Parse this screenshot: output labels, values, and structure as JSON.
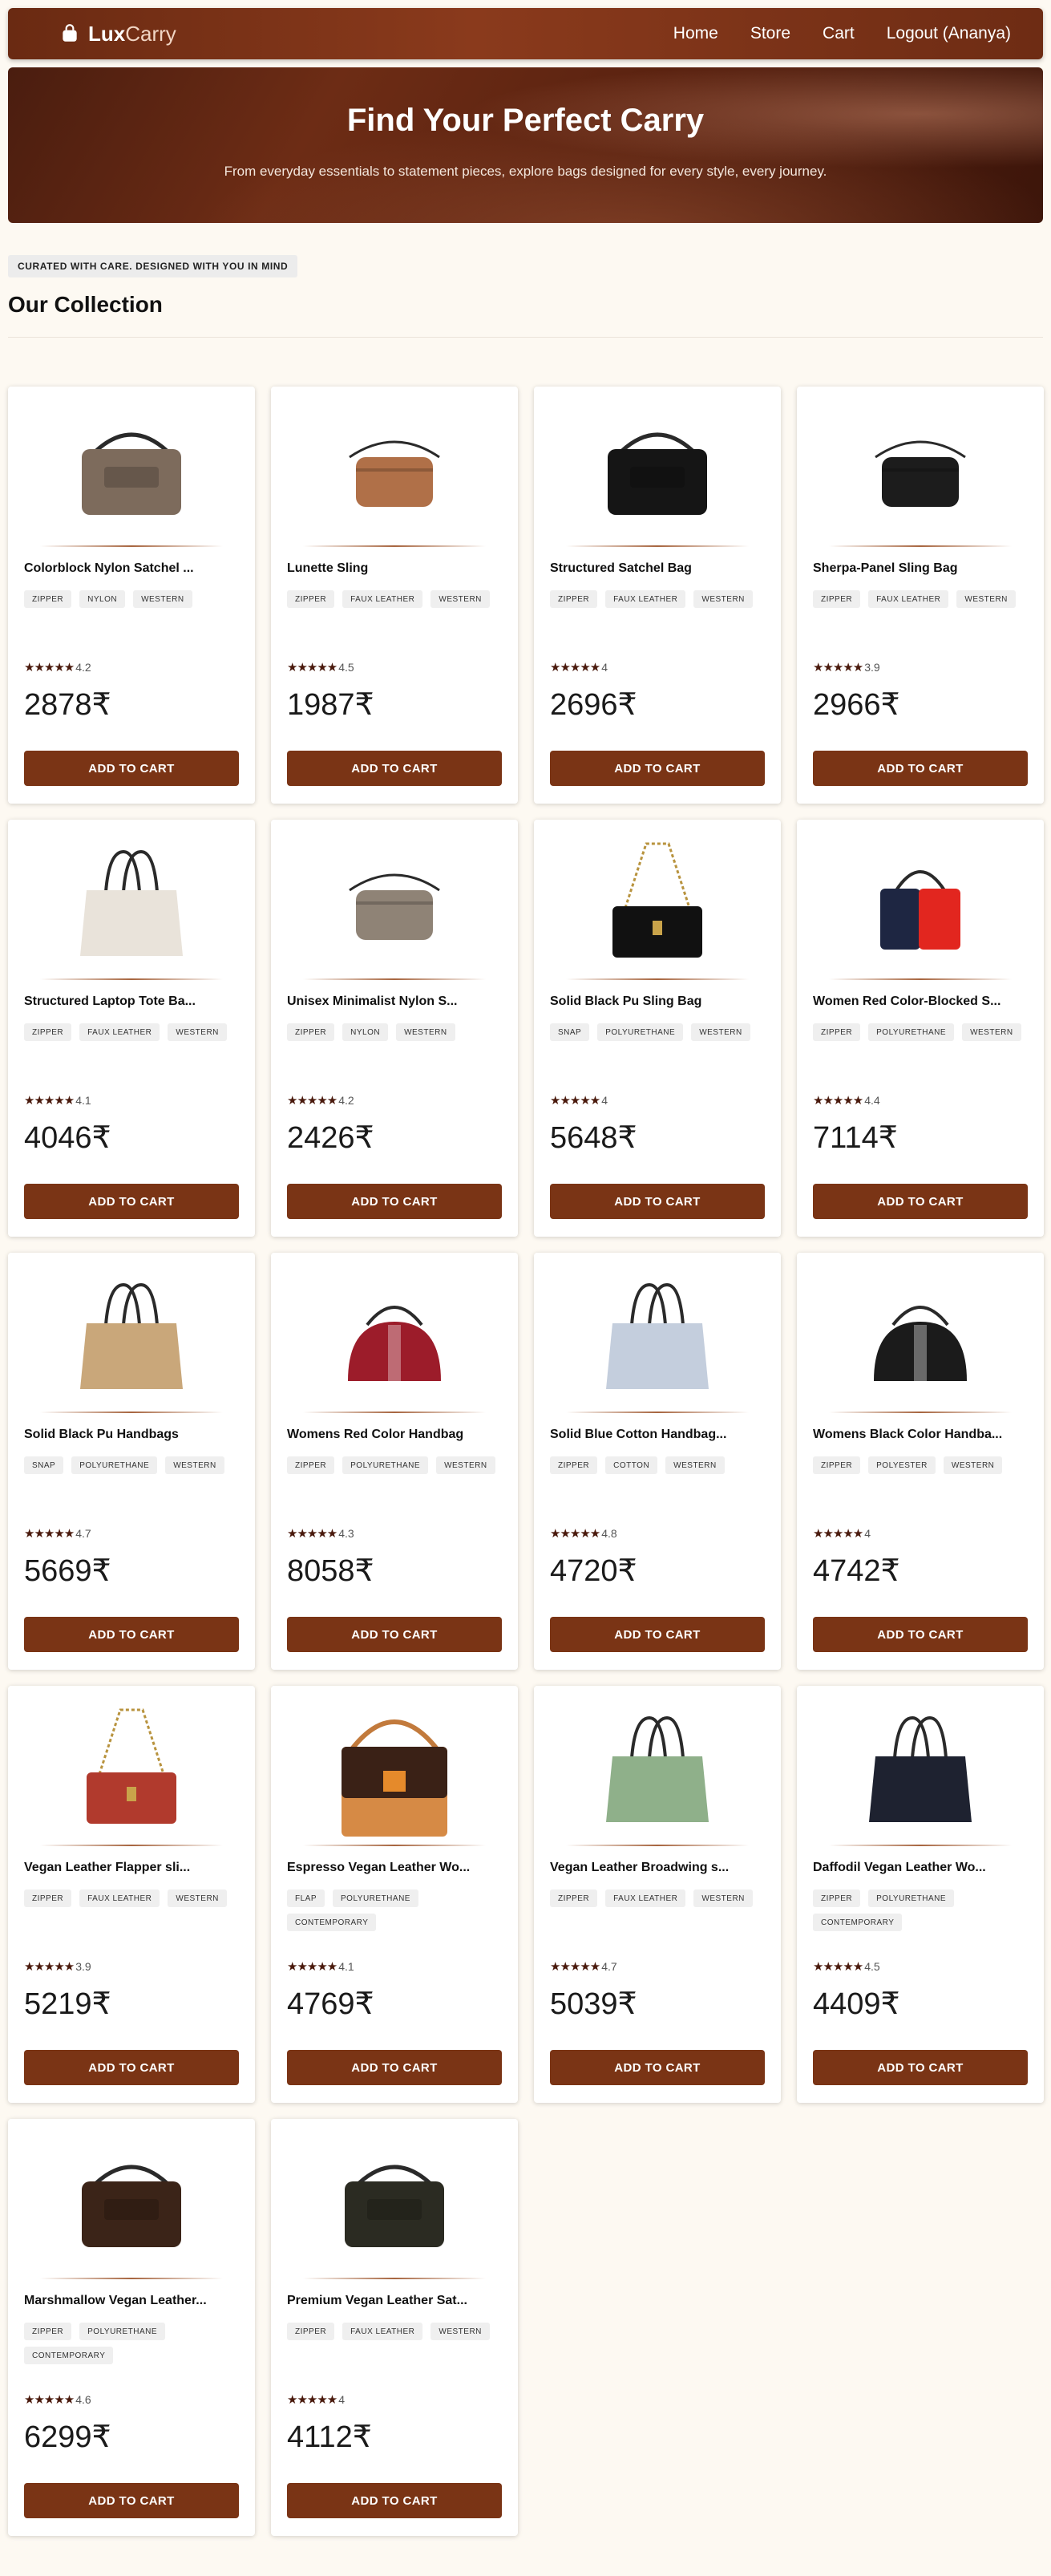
{
  "nav": {
    "brand_strong": "Lux",
    "brand_light": "Carry",
    "links": [
      "Home",
      "Store",
      "Cart",
      "Logout (Ananya)"
    ]
  },
  "hero": {
    "title": "Find Your Perfect Carry",
    "subtitle": "From everyday essentials to statement pieces, explore bags designed for every style, every journey."
  },
  "section": {
    "tagline": "CURATED WITH CARE. DESIGNED WITH YOU IN MIND",
    "title": "Our Collection"
  },
  "add_to_cart_label": "ADD TO CART",
  "currency_symbol": "₹",
  "stars_glyph": "★★★★★",
  "colors": {
    "brand": "#7a3415",
    "navbar": "#6a2a12",
    "star": "#4a1a0d"
  },
  "products": [
    {
      "title": "Colorblock Nylon Satchel ...",
      "tags": [
        "ZIPPER",
        "NYLON",
        "WESTERN"
      ],
      "rating": "4.2",
      "price": "2878₹",
      "icon": "satchel-bag-icon",
      "color": "#7d6b5c"
    },
    {
      "title": "Lunette Sling",
      "tags": [
        "ZIPPER",
        "FAUX LEATHER",
        "WESTERN"
      ],
      "rating": "4.5",
      "price": "1987₹",
      "icon": "sling-bag-icon",
      "color": "#b07048"
    },
    {
      "title": "Structured Satchel Bag",
      "tags": [
        "ZIPPER",
        "FAUX LEATHER",
        "WESTERN"
      ],
      "rating": "4",
      "price": "2696₹",
      "icon": "satchel-bag-icon",
      "color": "#151515"
    },
    {
      "title": "Sherpa-Panel Sling Bag",
      "tags": [
        "ZIPPER",
        "FAUX LEATHER",
        "WESTERN"
      ],
      "rating": "3.9",
      "price": "2966₹",
      "icon": "sling-bag-icon",
      "color": "#1c1c1c"
    },
    {
      "title": "Structured Laptop Tote Ba...",
      "tags": [
        "ZIPPER",
        "FAUX LEATHER",
        "WESTERN"
      ],
      "rating": "4.1",
      "price": "4046₹",
      "icon": "tote-bag-icon",
      "color": "#e9e3da"
    },
    {
      "title": "Unisex Minimalist Nylon S...",
      "tags": [
        "ZIPPER",
        "NYLON",
        "WESTERN"
      ],
      "rating": "4.2",
      "price": "2426₹",
      "icon": "sling-bag-icon",
      "color": "#8f8376"
    },
    {
      "title": "Solid Black Pu Sling Bag",
      "tags": [
        "SNAP",
        "POLYURETHANE",
        "WESTERN"
      ],
      "rating": "4",
      "price": "5648₹",
      "icon": "chain-sling-icon",
      "color": "#111111"
    },
    {
      "title": "Women Red Color-Blocked S...",
      "tags": [
        "ZIPPER",
        "POLYURETHANE",
        "WESTERN"
      ],
      "rating": "4.4",
      "price": "7114₹",
      "icon": "colorblock-bag-icon",
      "color": "#e2261f"
    },
    {
      "title": "Solid Black Pu Handbags",
      "tags": [
        "SNAP",
        "POLYURETHANE",
        "WESTERN"
      ],
      "rating": "4.7",
      "price": "5669₹",
      "icon": "tote-bag-icon",
      "color": "#c9a77a"
    },
    {
      "title": "Womens Red Color Handbag",
      "tags": [
        "ZIPPER",
        "POLYURETHANE",
        "WESTERN"
      ],
      "rating": "4.3",
      "price": "8058₹",
      "icon": "dome-bag-icon",
      "color": "#9c1c2a"
    },
    {
      "title": "Solid Blue Cotton Handbag...",
      "tags": [
        "ZIPPER",
        "COTTON",
        "WESTERN"
      ],
      "rating": "4.8",
      "price": "4720₹",
      "icon": "tote-bag-icon",
      "color": "#c4cedd"
    },
    {
      "title": "Womens Black Color Handba...",
      "tags": [
        "ZIPPER",
        "POLYESTER",
        "WESTERN"
      ],
      "rating": "4",
      "price": "4742₹",
      "icon": "dome-bag-icon",
      "color": "#1b1b1b"
    },
    {
      "title": "Vegan Leather Flapper sli...",
      "tags": [
        "ZIPPER",
        "FAUX LEATHER",
        "WESTERN"
      ],
      "rating": "3.9",
      "price": "5219₹",
      "icon": "chain-sling-icon",
      "color": "#b13a2d"
    },
    {
      "title": "Espresso Vegan Leather Wo...",
      "tags": [
        "FLAP",
        "POLYURETHANE",
        "CONTEMPORARY"
      ],
      "rating": "4.1",
      "price": "4769₹",
      "icon": "flap-bag-icon",
      "color": "#3a2116"
    },
    {
      "title": "Vegan Leather Broadwing s...",
      "tags": [
        "ZIPPER",
        "FAUX LEATHER",
        "WESTERN"
      ],
      "rating": "4.7",
      "price": "5039₹",
      "icon": "tote-bag-icon",
      "color": "#8fb08a"
    },
    {
      "title": "Daffodil Vegan Leather Wo...",
      "tags": [
        "ZIPPER",
        "POLYURETHANE",
        "CONTEMPORARY"
      ],
      "rating": "4.5",
      "price": "4409₹",
      "icon": "tote-bag-icon",
      "color": "#1e2230"
    },
    {
      "title": "Marshmallow Vegan Leather...",
      "tags": [
        "ZIPPER",
        "POLYURETHANE",
        "CONTEMPORARY"
      ],
      "rating": "4.6",
      "price": "6299₹",
      "icon": "satchel-bag-icon",
      "color": "#3b2418"
    },
    {
      "title": "Premium Vegan Leather Sat...",
      "tags": [
        "ZIPPER",
        "FAUX LEATHER",
        "WESTERN"
      ],
      "rating": "4",
      "price": "4112₹",
      "icon": "satchel-bag-icon",
      "color": "#2b2b22"
    }
  ]
}
